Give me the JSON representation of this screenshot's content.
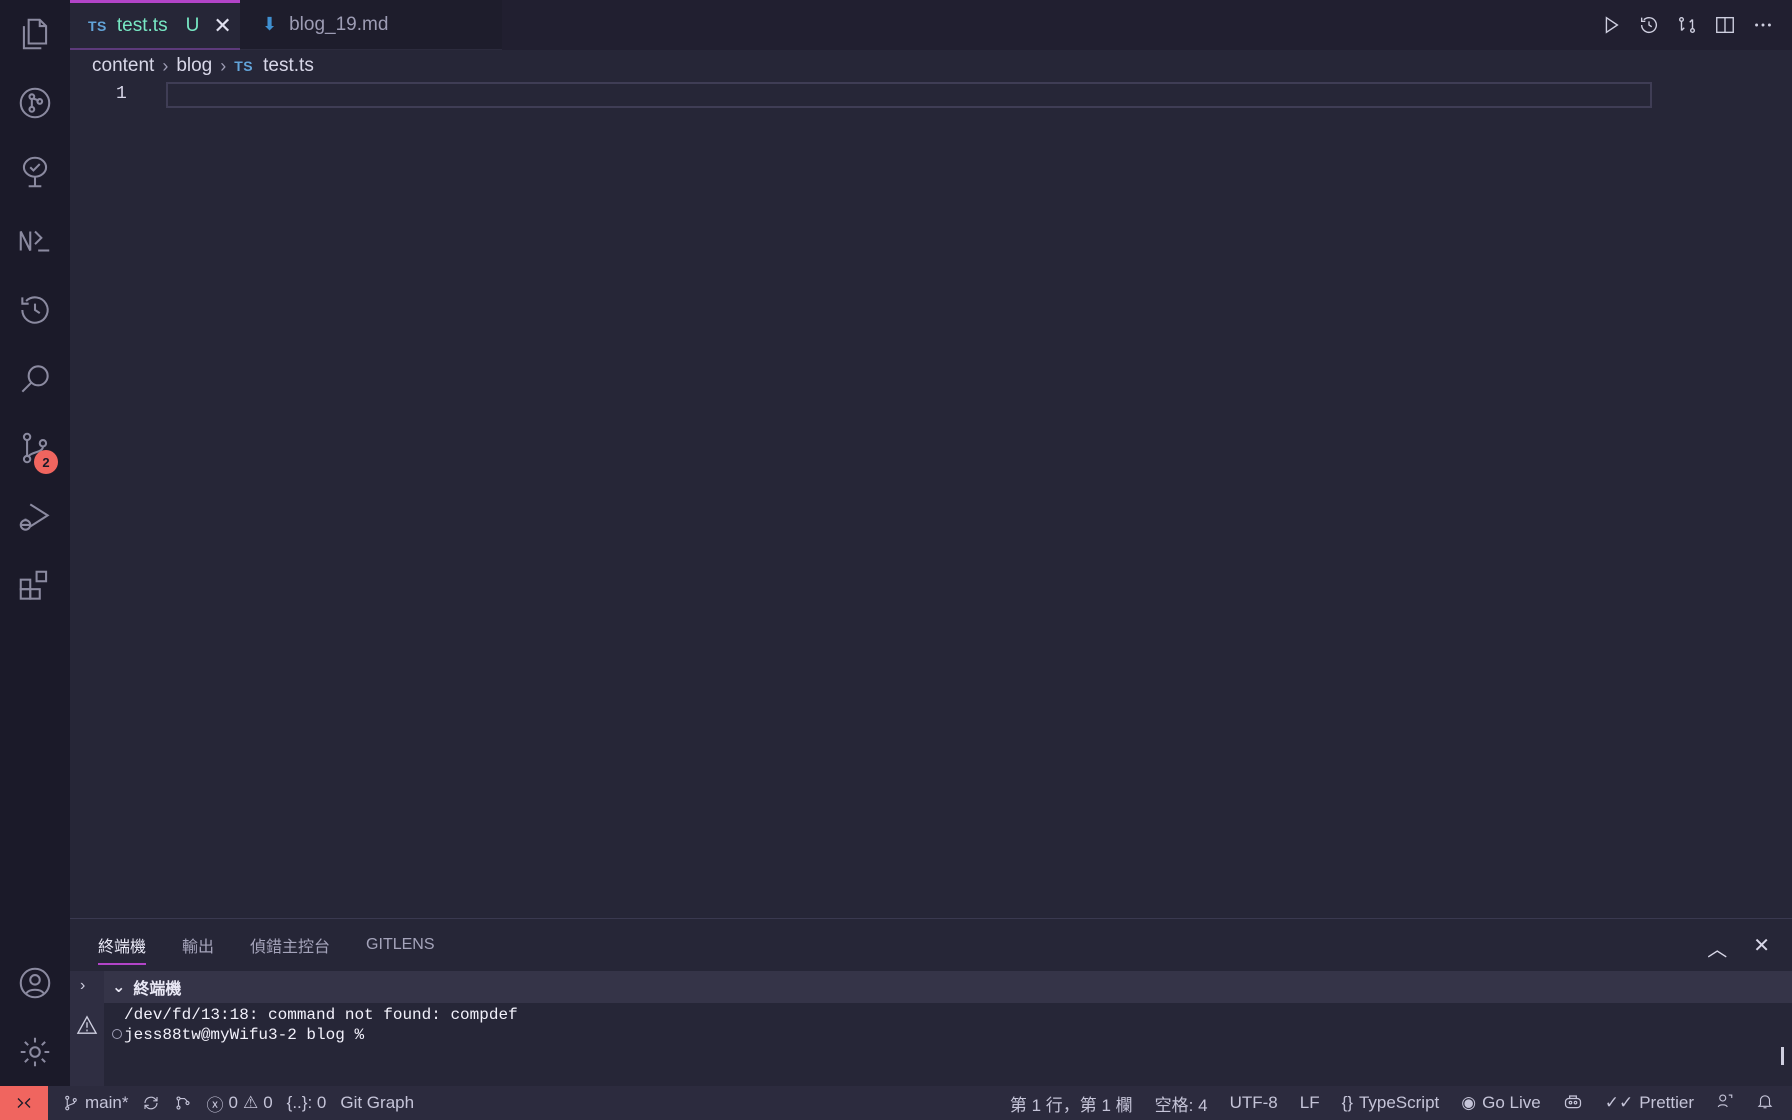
{
  "tabs": [
    {
      "type_badge": "TS",
      "title": "test.ts",
      "status": "U",
      "close": "✕"
    },
    {
      "title": "blog_19.md"
    }
  ],
  "breadcrumb": {
    "part1": "content",
    "part2": "blog",
    "type_badge": "TS",
    "file": "test.ts",
    "sep": "›"
  },
  "editor": {
    "line_number": "1"
  },
  "activity_bar": {
    "source_control_badge": "2"
  },
  "panel": {
    "tabs": [
      "終端機",
      "輸出",
      "偵錯主控台",
      "GITLENS"
    ],
    "terminal_name": "終端機",
    "lines": [
      "/dev/fd/13:18: command not found: compdef",
      "jess88tw@myWifu3-2 blog %"
    ]
  },
  "status_bar": {
    "branch": "main*",
    "errors": "0",
    "warnings": "0",
    "braces": "{..}: 0",
    "git_graph": "Git Graph",
    "position": "第 1 行，第 1 欄",
    "spaces": "空格: 4",
    "encoding": "UTF-8",
    "eol": "LF",
    "language": "TypeScript",
    "language_prefix": "{}",
    "go_live": "Go Live",
    "prettier": "Prettier"
  },
  "colors": {
    "accent": "#b244c8",
    "remote": "#f0655f",
    "untracked": "#77e7c3",
    "background": "#262637"
  }
}
